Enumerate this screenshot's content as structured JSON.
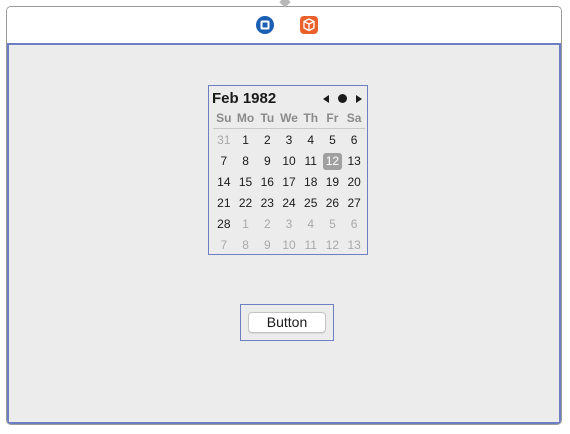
{
  "titlebar": {
    "icons": [
      "view-controller-icon",
      "cube-icon"
    ],
    "colors": {
      "primary": "#1a5fb4",
      "secondary": "#e8612c"
    }
  },
  "datepicker": {
    "month_label": "Feb 1982",
    "weekdays": [
      "Su",
      "Mo",
      "Tu",
      "We",
      "Th",
      "Fr",
      "Sa"
    ],
    "days": [
      {
        "d": "31",
        "muted": true
      },
      {
        "d": "1"
      },
      {
        "d": "2"
      },
      {
        "d": "3"
      },
      {
        "d": "4"
      },
      {
        "d": "5"
      },
      {
        "d": "6"
      },
      {
        "d": "7"
      },
      {
        "d": "8"
      },
      {
        "d": "9"
      },
      {
        "d": "10"
      },
      {
        "d": "11"
      },
      {
        "d": "12",
        "selected": true
      },
      {
        "d": "13"
      },
      {
        "d": "14"
      },
      {
        "d": "15"
      },
      {
        "d": "16"
      },
      {
        "d": "17"
      },
      {
        "d": "18"
      },
      {
        "d": "19"
      },
      {
        "d": "20"
      },
      {
        "d": "21"
      },
      {
        "d": "22"
      },
      {
        "d": "23"
      },
      {
        "d": "24"
      },
      {
        "d": "25"
      },
      {
        "d": "26"
      },
      {
        "d": "27"
      },
      {
        "d": "28"
      },
      {
        "d": "1",
        "muted": true
      },
      {
        "d": "2",
        "muted": true
      },
      {
        "d": "3",
        "muted": true
      },
      {
        "d": "4",
        "muted": true
      },
      {
        "d": "5",
        "muted": true
      },
      {
        "d": "6",
        "muted": true
      },
      {
        "d": "7",
        "muted": true
      },
      {
        "d": "8",
        "muted": true
      },
      {
        "d": "9",
        "muted": true
      },
      {
        "d": "10",
        "muted": true
      },
      {
        "d": "11",
        "muted": true
      },
      {
        "d": "12",
        "muted": true
      },
      {
        "d": "13",
        "muted": true
      }
    ],
    "selection_color": "#a0a0a0"
  },
  "button": {
    "label": "Button"
  }
}
